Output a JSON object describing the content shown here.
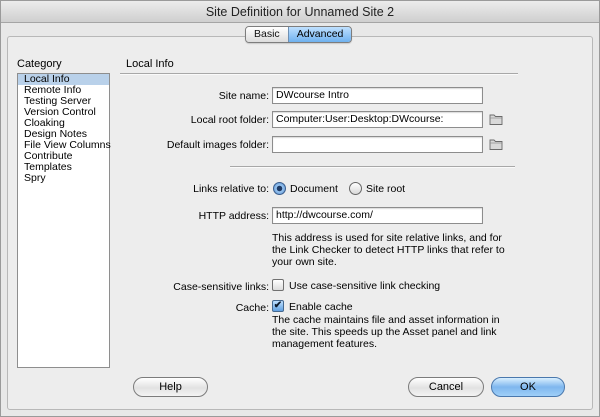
{
  "window": {
    "title": "Site Definition for Unnamed Site 2"
  },
  "tabs": [
    {
      "label": "Basic",
      "active": false
    },
    {
      "label": "Advanced",
      "active": true
    }
  ],
  "sidebar": {
    "heading": "Category",
    "items": [
      {
        "label": "Local Info",
        "selected": true
      },
      {
        "label": "Remote Info"
      },
      {
        "label": "Testing Server"
      },
      {
        "label": "Version Control"
      },
      {
        "label": "Cloaking"
      },
      {
        "label": "Design Notes"
      },
      {
        "label": "File View Columns"
      },
      {
        "label": "Contribute"
      },
      {
        "label": "Templates"
      },
      {
        "label": "Spry"
      }
    ]
  },
  "main": {
    "heading": "Local Info",
    "site_name": {
      "label": "Site name:",
      "value": "DWcourse Intro"
    },
    "local_root": {
      "label": "Local root folder:",
      "value": "Computer:User:Desktop:DWcourse:"
    },
    "default_images": {
      "label": "Default images folder:",
      "value": ""
    },
    "links_relative": {
      "label": "Links relative to:",
      "options": [
        {
          "label": "Document",
          "selected": true
        },
        {
          "label": "Site root",
          "selected": false
        }
      ]
    },
    "http_address": {
      "label": "HTTP address:",
      "value": "http://dwcourse.com/",
      "help": "This address is used for site relative links, and for the Link Checker to detect HTTP links that refer to your own site."
    },
    "case_sensitive": {
      "label": "Case-sensitive links:",
      "checkbox_label": "Use case-sensitive link checking",
      "checked": false
    },
    "cache": {
      "label": "Cache:",
      "checkbox_label": "Enable cache",
      "checked": true,
      "help": "The cache maintains file and asset information in the site.  This speeds up the Asset panel and link management features."
    }
  },
  "buttons": {
    "help": "Help",
    "cancel": "Cancel",
    "ok": "OK"
  },
  "icons": {
    "folder": "folder-icon",
    "check": "checkmark-icon"
  },
  "colors": {
    "selection": "#b9d1ea",
    "accent": "#6fb1ef"
  }
}
